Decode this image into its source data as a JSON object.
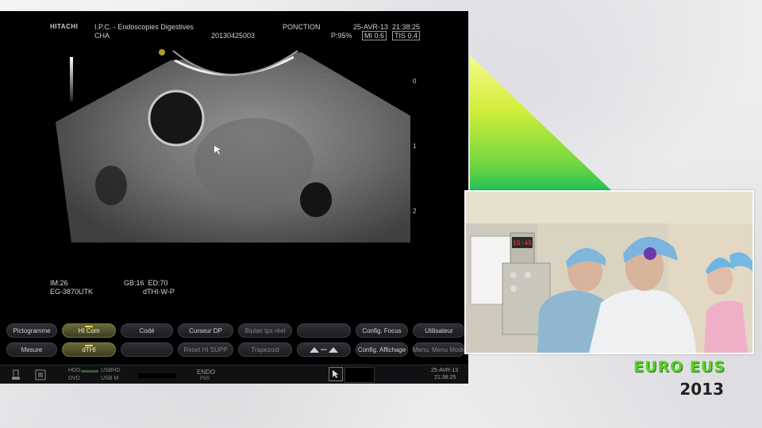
{
  "monitor": {
    "logo": "HITACHI",
    "institution": "I.P.C. - Endoscopies Digestives",
    "patient": "CHA",
    "study_id": "20130425003",
    "mode_label": "PONCTION",
    "power": "P:95%",
    "date": "25-AVR-13",
    "time": "21:38:25",
    "mi": "MI 0.6",
    "tis": "TIS 0.4",
    "depth_marks": [
      "0",
      "1",
      "2"
    ],
    "image_info": {
      "im": "IM:26",
      "probe": "EG-3870UTK",
      "gb": "GB:16",
      "ed": "ED:70",
      "mode": "dTHI-W-P"
    }
  },
  "softkeys": {
    "row1": [
      {
        "label": "Pictogramme",
        "active": false,
        "dim": false
      },
      {
        "label": "HI Com",
        "active": true,
        "dim": false
      },
      {
        "label": "Codé",
        "active": false,
        "dim": false
      },
      {
        "label": "Curseur DP",
        "active": false,
        "dim": false
      },
      {
        "label": "Biplan tps réel",
        "active": false,
        "dim": true
      },
      {
        "label": "",
        "active": false,
        "dim": true
      },
      {
        "label": "Config. Focus",
        "active": false,
        "dim": false
      },
      {
        "label": "Utilisateur",
        "active": false,
        "dim": false
      }
    ],
    "row2": [
      {
        "label": "Mesure",
        "active": false,
        "dim": false
      },
      {
        "label": "dTHI",
        "active": true,
        "dim": false
      },
      {
        "label": "",
        "active": false,
        "dim": true
      },
      {
        "label": "Reset HI SUPP",
        "active": false,
        "dim": true
      },
      {
        "label": "Trapezoid",
        "active": false,
        "dim": true
      },
      {
        "label": "",
        "active": false,
        "dim": false
      },
      {
        "label": "Config. Affichage",
        "active": false,
        "dim": false
      },
      {
        "label": "Menu, Menu Mode",
        "active": false,
        "dim": true
      }
    ]
  },
  "statusbar": {
    "hdd": "HDD",
    "dvd": "DVD",
    "usb_hd": "USBHD",
    "usb_m": "USB M",
    "endo": "ENDO",
    "pss": "PSS",
    "date": "25-AVR-13",
    "time": "21:38:25"
  },
  "camera": {
    "clock": "15:45"
  },
  "brand": {
    "line1": "EURO EUS",
    "line2": "2013"
  },
  "colors": {
    "accent_green": "#59d22a",
    "triangle_top": "#eef56a",
    "triangle_bottom": "#27c25a"
  }
}
